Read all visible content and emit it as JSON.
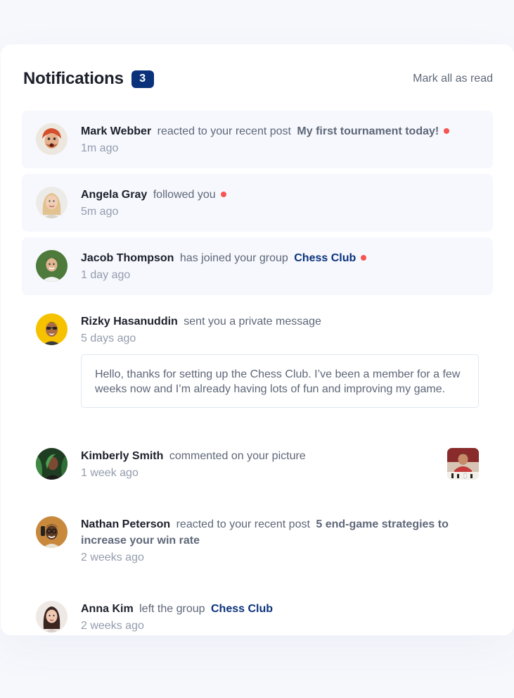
{
  "header": {
    "title": "Notifications",
    "badge_count": "3",
    "mark_all_label": "Mark all as read"
  },
  "colors": {
    "badge_bg": "#0a327b",
    "unread_bg": "#f6f8fd",
    "dot": "#f65552",
    "group_link": "#0a327b"
  },
  "notifications": [
    {
      "name": "Mark Webber",
      "action": "reacted to your recent post",
      "post": "My first tournament today!",
      "time": "1m ago",
      "unread": true
    },
    {
      "name": "Angela Gray",
      "action": "followed you",
      "time": "5m ago",
      "unread": true
    },
    {
      "name": "Jacob Thompson",
      "action": "has joined your group",
      "group": "Chess Club",
      "time": "1 day ago",
      "unread": true
    },
    {
      "name": "Rizky Hasanuddin",
      "action": "sent you a private message",
      "time": "5 days ago",
      "unread": false,
      "message": "Hello, thanks for setting up the Chess Club. I’ve been a member for a few weeks now and I’m already having lots of fun and improving my game."
    },
    {
      "name": "Kimberly Smith",
      "action": "commented on your picture",
      "time": "1 week ago",
      "unread": false
    },
    {
      "name": "Nathan Peterson",
      "action": "reacted to your recent post",
      "post": "5 end-game strategies to increase your win rate",
      "time": "2 weeks ago",
      "unread": false
    },
    {
      "name": "Anna Kim",
      "action": "left the group",
      "group": "Chess Club",
      "time": "2 weeks ago",
      "unread": false
    }
  ]
}
